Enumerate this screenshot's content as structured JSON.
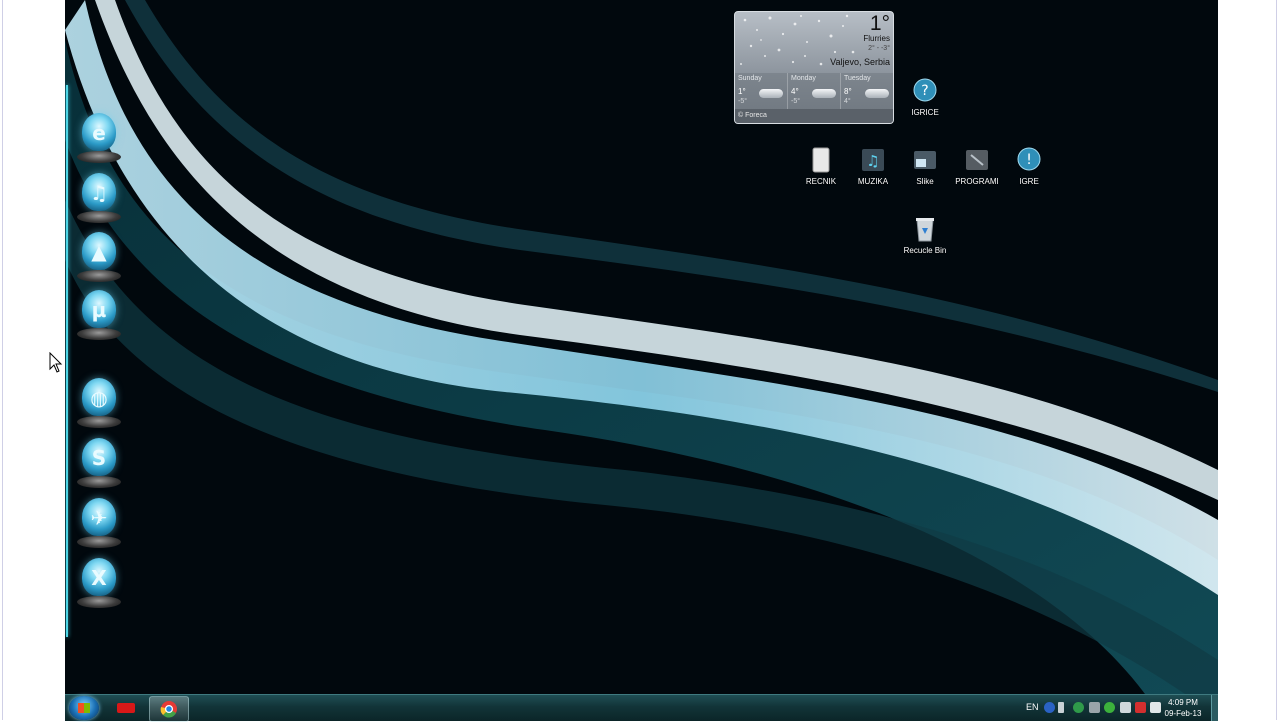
{
  "weather": {
    "temperature": "1°",
    "condition": "Flurries",
    "hilo": "2° - -3°",
    "location": "Valjevo, Serbia",
    "forecast": [
      {
        "day": "Sunday",
        "high": "1°",
        "low": "-5°"
      },
      {
        "day": "Monday",
        "high": "4°",
        "low": "-5°"
      },
      {
        "day": "Tuesday",
        "high": "8°",
        "low": "4°"
      }
    ],
    "credit": "© Foreca"
  },
  "desktop_icons": {
    "igrice": "IGRICE",
    "recnik": "RECNIK",
    "muzika": "MUZIKA",
    "slike": "Slike",
    "programi": "PROGRAMI",
    "igre": "IGRE",
    "recycle_bin": "Recucle Bin"
  },
  "dock": {
    "items": [
      {
        "name": "internet-explorer",
        "glyph": "e"
      },
      {
        "name": "music",
        "glyph": "♫"
      },
      {
        "name": "pictures",
        "glyph": "▲"
      },
      {
        "name": "utorrent",
        "glyph": "µ"
      },
      {
        "name": "globe",
        "glyph": "◍"
      },
      {
        "name": "skype",
        "glyph": "S"
      },
      {
        "name": "email",
        "glyph": "✈"
      },
      {
        "name": "xbox",
        "glyph": "X"
      }
    ]
  },
  "taskbar": {
    "language": "EN",
    "time": "4:09 PM",
    "date": "09-Feb-13"
  },
  "colors": {
    "accent": "#4ed6e6",
    "taskbar": "#123438",
    "wallpaper": "#01080d"
  }
}
